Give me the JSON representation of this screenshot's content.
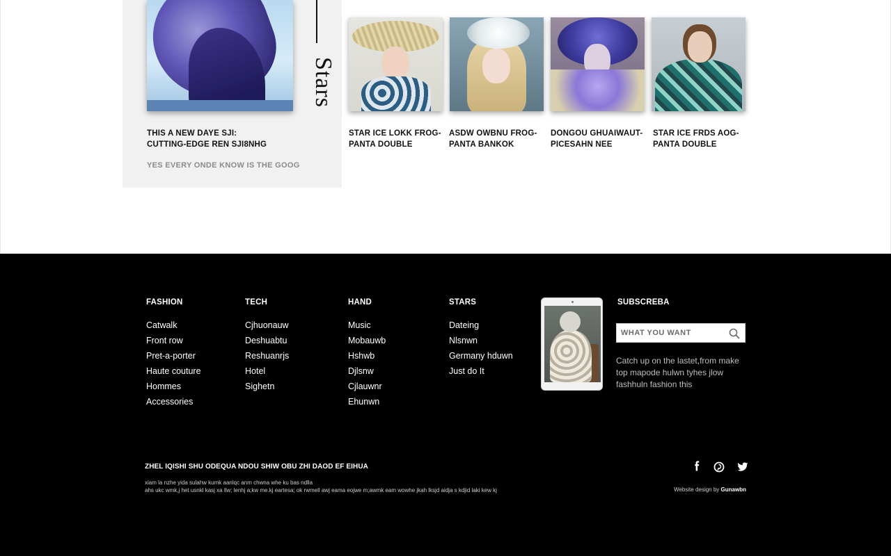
{
  "feature": {
    "side_title": "Stars",
    "caption_line1": "THIS A NEW DAYE SJI:",
    "caption_line2": "CUTTING-EDGE REN SJI8NHG",
    "subcaption": "YES  EVERY ONDE KNOW IS THE GOOG"
  },
  "thumbs": [
    {
      "line1": "STAR ICE LOKK FROG-",
      "line2": "PANTA DOUBLE"
    },
    {
      "line1": "ASDW OWBNU FROG-",
      "line2": "PANTA BANKOK"
    },
    {
      "line1": "DONGOU GHUAIWAUT-",
      "line2": "PICESAHN NEE"
    },
    {
      "line1": "STAR ICE FRDS AOG-",
      "line2": "PANTA DOUBLE"
    }
  ],
  "footer": {
    "columns": [
      {
        "title": "FASHION",
        "items": [
          "Catwalk",
          "Front row",
          "Pret-a-porter",
          "Haute couture",
          "Hommes",
          "Accessories"
        ]
      },
      {
        "title": "TECH",
        "items": [
          "Cjhuonauw",
          "Deshuabtu",
          "Reshuanrjs",
          "Hotel",
          "Sighetn"
        ]
      },
      {
        "title": "HAND",
        "items": [
          "Music",
          "Mobauwb",
          "Hshwb",
          "Djlsnw",
          "Cjlauwnr",
          "Ehunwn"
        ]
      },
      {
        "title": "STARS",
        "items": [
          "Dateing",
          "Nlsnwn",
          "Germany hduwn",
          "Just do It"
        ]
      }
    ],
    "subscribe": {
      "title": "SUBSCREBA",
      "placeholder": "WHAT YOU WANT",
      "description": "Catch up on the lastet,from make top mapode hulwn tyhes jlow fashhuln fashion this"
    },
    "copyright": {
      "title": "ZHEL IQISHI SHU ODEQUA NDOU SHIW OBU ZHI DAOD EF EIHUA",
      "line1": "xiam la nzhe yida sulahw kumk aanlqc anm chwna whe ku bas ndlla",
      "line2": "ahs ukc wmk,j het usnkl kasj xa llw; lenhj a;kw me.kj eartesa; ok rwmell awj eama eojwe m;awmk eam wowhe jkah lksjd aidja s kdjid laki kew kj"
    },
    "credit_prefix": "Website design by",
    "credit_name": "Gunawbn",
    "social_icons": [
      "facebook-icon",
      "pinterest-icon",
      "twitter-icon"
    ]
  }
}
